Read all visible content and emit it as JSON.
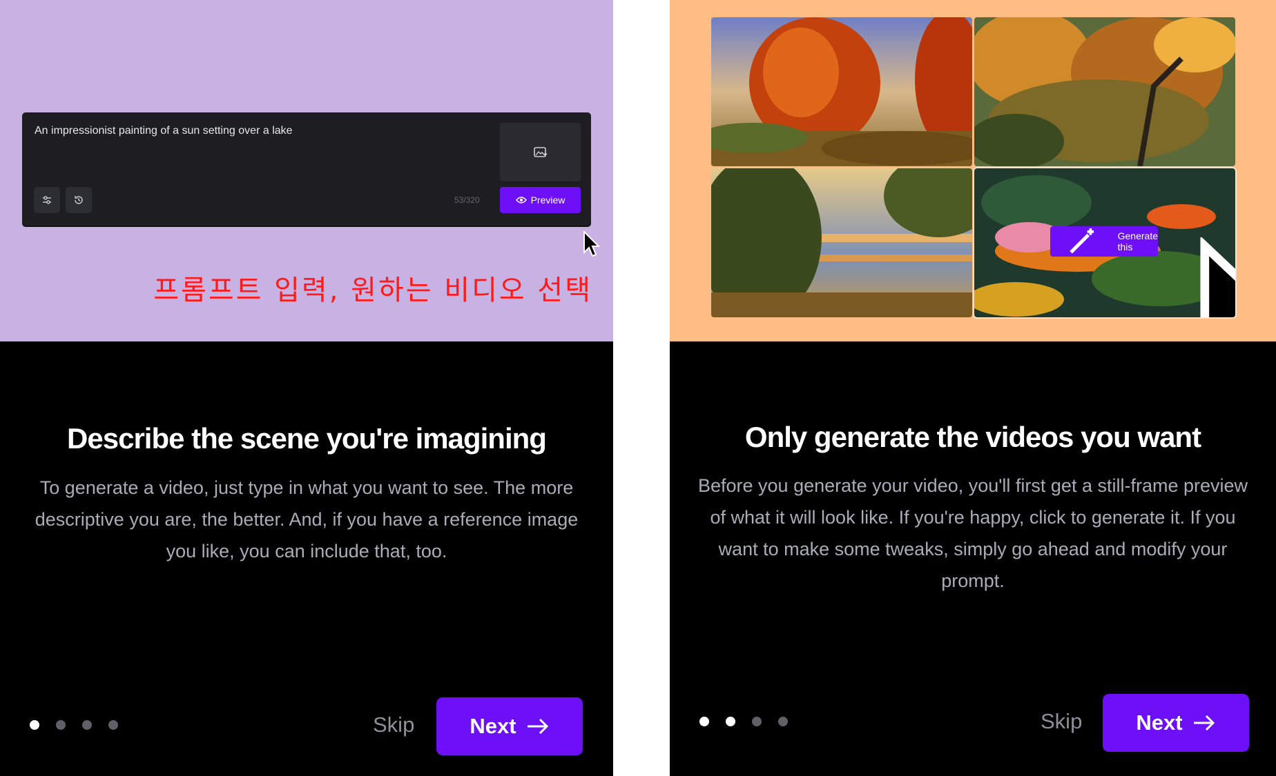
{
  "left": {
    "prompt": {
      "text": "An impressionist painting of a sun setting over a lake",
      "char_count": "53/320",
      "preview_label": "Preview"
    },
    "caption": "프롬프트 입력, 원하는 비디오 선택",
    "headline": "Describe the scene you're imagining",
    "body": "To generate a video, just type in what you want to see. The more descriptive you are, the better. And, if you have a reference image you like, you can include that, too.",
    "pagination": {
      "total": 4,
      "active": 1
    },
    "skip_label": "Skip",
    "next_label": "Next"
  },
  "right": {
    "generate_label": "Generate this",
    "headline": "Only generate the videos you want",
    "body": "Before you generate your video, you'll first get a still-frame preview of what it will look like. If you're happy, click to generate it. If you want to make some tweaks, simply go ahead and modify your prompt.",
    "pagination": {
      "total": 4,
      "active": 2
    },
    "skip_label": "Skip",
    "next_label": "Next"
  },
  "colors": {
    "accent": "#6d0ff7",
    "left_hero": "#c8b2e4",
    "right_hero": "#ffbd86",
    "caption": "#ff1a1a"
  },
  "icons": [
    "settings-sliders-icon",
    "history-icon",
    "image-upload-icon",
    "eye-icon",
    "magic-wand-icon",
    "arrow-right-icon",
    "mouse-cursor-icon"
  ]
}
